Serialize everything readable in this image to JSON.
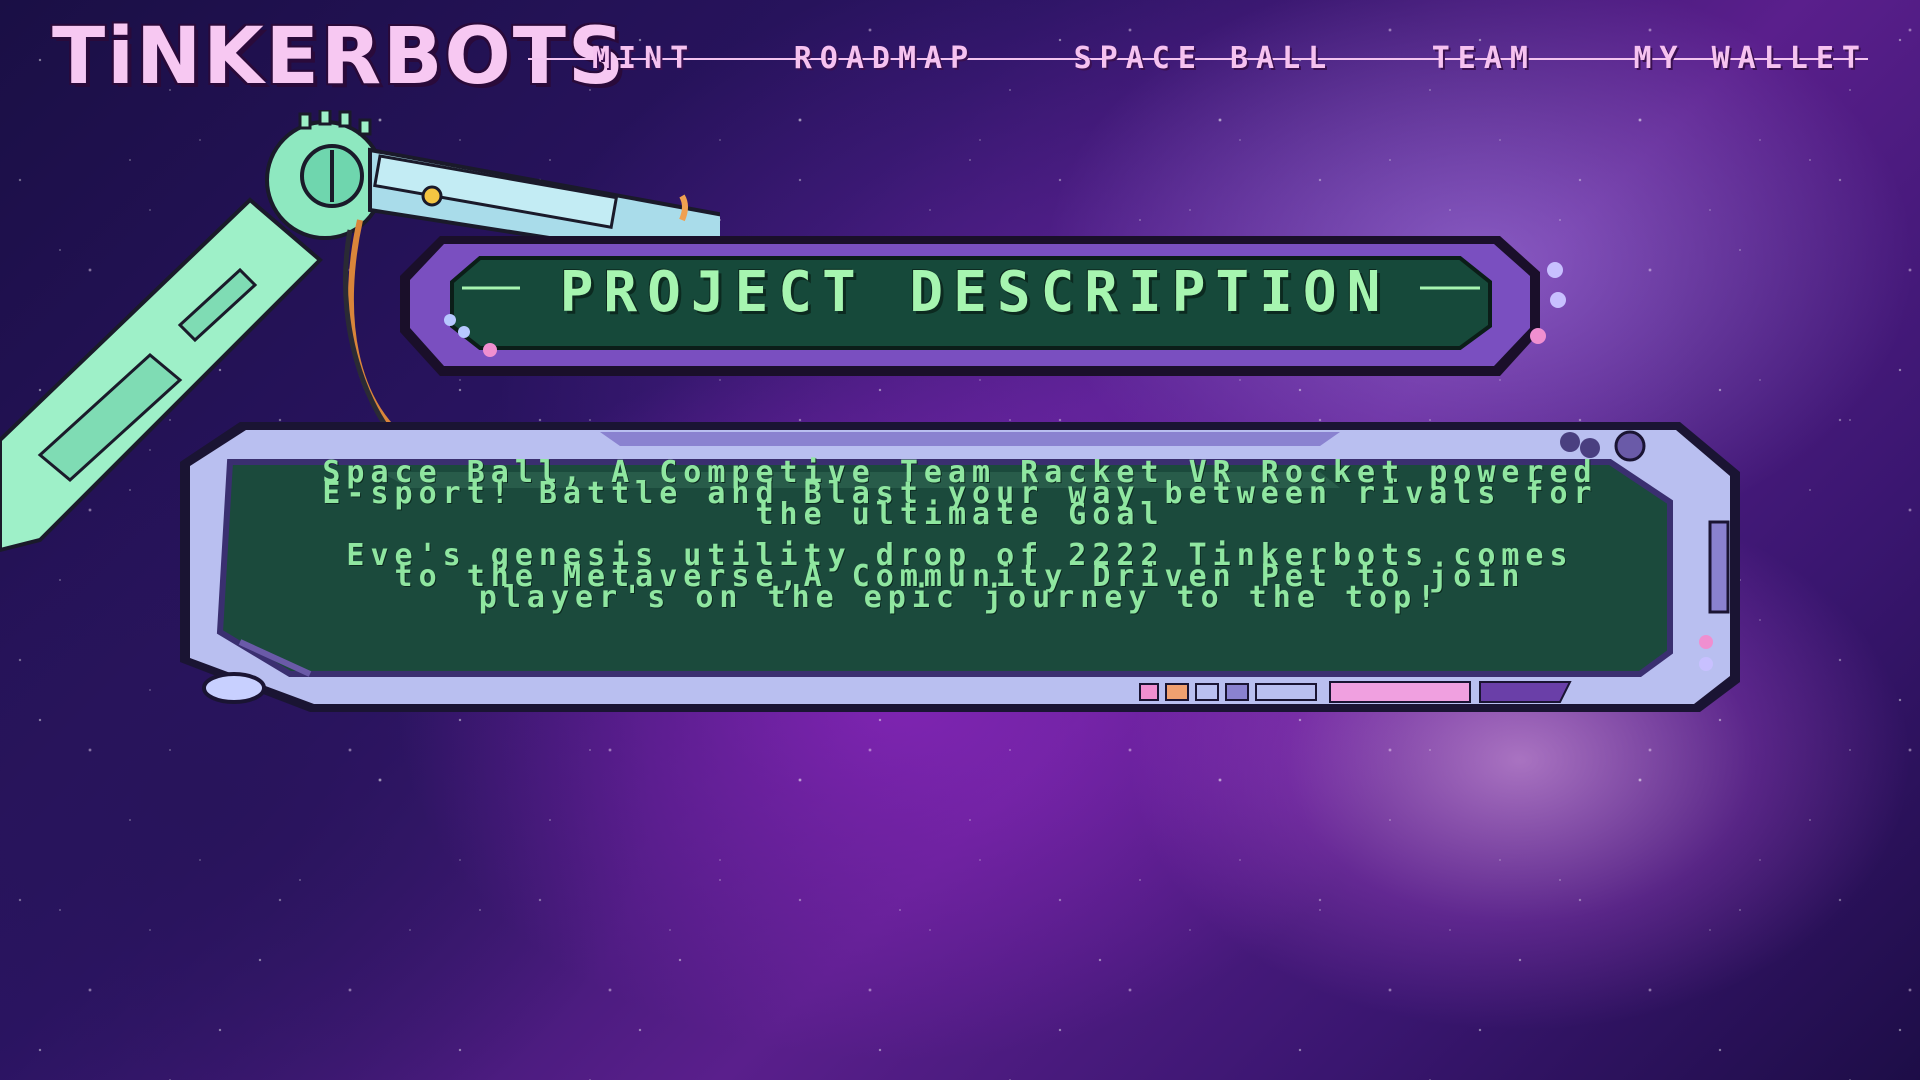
{
  "brand": {
    "logo_text": "TiNKERBOTS"
  },
  "nav": {
    "items": [
      {
        "label": "MINT"
      },
      {
        "label": "ROADMAP"
      },
      {
        "label": "SPACE BALL"
      },
      {
        "label": "TEAM"
      },
      {
        "label": "MY WALLET"
      }
    ]
  },
  "section": {
    "title": "PROJECT DESCRIPTION",
    "paragraphs": [
      "Space Ball, A Competive Team Racket VR Rocket powered E-sport! Battle and Blast your way between rivals for the ultimate Goal",
      "Eve's genesis utility drop of 2222 Tinkerbots comes to the Metaverse,A Community Driven Pet to join player's on the epic journey to the top!"
    ]
  },
  "colors": {
    "nav_pink": "#f6c2f0",
    "title_green": "#a6f5b0",
    "screen_green": "#1b4a3c",
    "frame_lavender": "#b9bff0",
    "plate_purple": "#7a4fc0"
  },
  "icons": [
    "robot-arm-icon",
    "bolt-icon"
  ]
}
